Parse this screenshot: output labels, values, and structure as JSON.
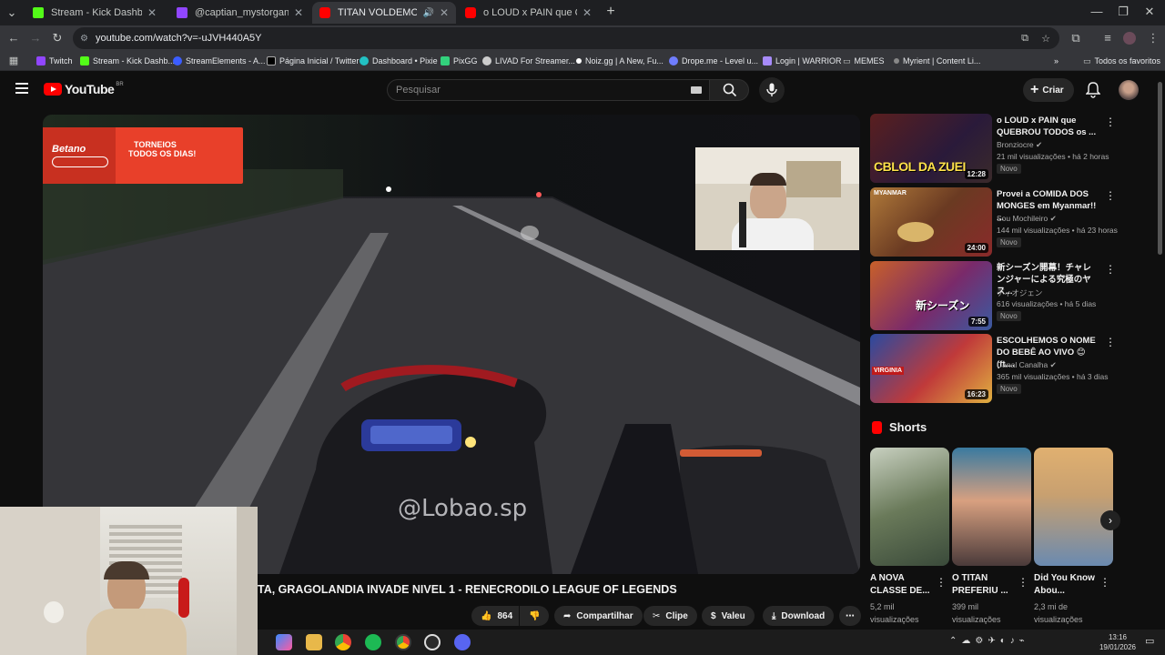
{
  "tabs": [
    {
      "title": "Stream - Kick Dashboard",
      "color": "#53fc18"
    },
    {
      "title": "@captian_mystorgan menti",
      "color": "#9146ff"
    },
    {
      "title": "TITAN VOLDEMORT DA ILH",
      "color": "#ff0000"
    },
    {
      "title": "o LOUD x PAIN que QUEBROU",
      "color": "#ff0000"
    }
  ],
  "address": "youtube.com/watch?v=-uJVH440A5Y",
  "bookmarks": [
    {
      "label": "Twitch",
      "color": "#9146ff"
    },
    {
      "label": "Stream - Kick Dashb...",
      "color": "#53fc18"
    },
    {
      "label": "StreamElements - A...",
      "color": "#3b5dff"
    },
    {
      "label": "Página Inicial / Twitter",
      "color": "#e8eaed"
    },
    {
      "label": "Dashboard • Pixie",
      "color": "#22c1c3"
    },
    {
      "label": "PixGG",
      "color": "#32d17c"
    },
    {
      "label": "LIVAD For Streamer...",
      "color": "#cccccc"
    },
    {
      "label": "Noiz.gg | A New, Fu...",
      "color": "#ffffff"
    },
    {
      "label": "Drope.me - Level u...",
      "color": "#6f7dff"
    },
    {
      "label": "Login | WARRIOR",
      "color": "#a78bfa"
    },
    {
      "label": "MEMES",
      "color": "#aaaaaa"
    },
    {
      "label": "Myrient | Content Li...",
      "color": "#888888"
    }
  ],
  "bookmarks_all": "Todos os favoritos",
  "youtube": {
    "logo_text": "YouTube",
    "region": "BR",
    "search_placeholder": "Pesquisar",
    "create_label": "Criar"
  },
  "overlay": {
    "watermark": "@Lobao.sp",
    "ad_brand": "Betano",
    "ad_line1": "TORNEIOS",
    "ad_line2": "TODOS OS DIAS!"
  },
  "video_title": "TA, GRAGOLANDIA INVADE NIVEL 1 - RENECRODILO LEAGUE OF LEGENDS",
  "actions": {
    "likes": "864",
    "share": "Compartilhar",
    "clip": "Clipe",
    "thanks": "Valeu",
    "download": "Download"
  },
  "recommendations": [
    {
      "title": "o LOUD x PAIN que QUEBROU TODOS os ...",
      "channel": "Bronziocre",
      "stats": "21 mil visualizações • há 2 horas",
      "badge": "Novo",
      "duration": "12:28",
      "thumb_text": "CBLOL DA ZUEI"
    },
    {
      "title": "Provei a COMIDA DOS MONGES em Myanmar!! ...",
      "channel": "Sou Mochileiro",
      "stats": "144 mil visualizações • há 23 horas",
      "badge": "Novo",
      "duration": "24:00",
      "thumb_text": "MYANMAR"
    },
    {
      "title": "新シーズン開幕！チャレンジャーによる究極のヤス...",
      "channel": "ディオジェン",
      "stats": "616 visualizações • há 5 dias",
      "badge": "Novo",
      "duration": "7:55",
      "thumb_text": "新シーズン"
    },
    {
      "title": "ESCOLHEMOS O NOME DO BEBÊ AO VIVO 😊 (ft....",
      "channel": "Canal Canalha",
      "stats": "365 mil visualizações • há 3 dias",
      "badge": "Novo",
      "duration": "16:23",
      "thumb_text": "VIRGINIA"
    }
  ],
  "shorts_heading": "Shorts",
  "shorts": [
    {
      "title": "A NOVA CLASSE DE...",
      "stats": "5,2 mil visualizações"
    },
    {
      "title": "O TITAN PREFERIU ...",
      "stats": "399 mil visualizações"
    },
    {
      "title": "Did You Know Abou...",
      "stats": "2,3 mi de visualizações"
    }
  ],
  "clock": {
    "time": "13:16",
    "date": "19/01/2026"
  },
  "colors": {
    "yt_red": "#ff0000",
    "bg": "#0f0f0f"
  }
}
